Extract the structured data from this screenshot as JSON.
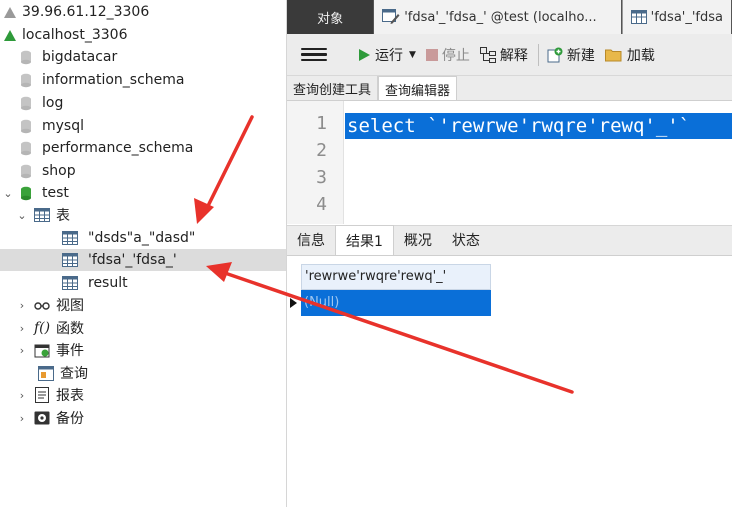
{
  "navigator": {
    "connections": [
      {
        "label": "39.96.61.12_3306"
      },
      {
        "label": "localhost_3306"
      }
    ],
    "databases": [
      {
        "label": "bigdatacar"
      },
      {
        "label": "information_schema"
      },
      {
        "label": "log"
      },
      {
        "label": "mysql"
      },
      {
        "label": "performance_schema"
      },
      {
        "label": "shop"
      },
      {
        "label": "test"
      }
    ],
    "tables_node": {
      "label": "表"
    },
    "tables": [
      {
        "label": "\"dsds\"a_\"dasd\""
      },
      {
        "label": "'fdsa'_'fdsa_'"
      },
      {
        "label": "result"
      }
    ],
    "groups": [
      {
        "label": "视图",
        "icon": "view-icon"
      },
      {
        "label": "函数",
        "icon": "function-icon"
      },
      {
        "label": "事件",
        "icon": "event-icon"
      },
      {
        "label": "查询",
        "icon": "query-icon"
      },
      {
        "label": "报表",
        "icon": "report-icon"
      },
      {
        "label": "备份",
        "icon": "backup-icon"
      }
    ]
  },
  "tabs": {
    "objects": "对象",
    "query_tab": "'fdsa'_'fdsa_' @test (localho...",
    "table_tab": "'fdsa'_'fdsa"
  },
  "toolbar": {
    "run": "运行",
    "stop": "停止",
    "explain": "解释",
    "new": "新建",
    "load": "加载"
  },
  "subtabs": {
    "builder": "查询创建工具",
    "editor": "查询编辑器"
  },
  "editor": {
    "line_numbers": [
      "1",
      "2",
      "3",
      "4"
    ],
    "code": "select `'rewrwe'rwqre'rewq'_'`"
  },
  "result_tabs": {
    "info": "信息",
    "result1": "结果1",
    "overview": "概况",
    "status": "状态"
  },
  "grid": {
    "column": "'rewrwe'rwqre'rewq'_'",
    "value": "(Null)"
  },
  "colors": {
    "selection_blue": "#0a6fd8",
    "tab_bar": "#2f2f2f",
    "arrow_red": "#e8322b",
    "db_icon_gray": "#c4c4c4",
    "db_icon_green": "#3aa23a"
  }
}
